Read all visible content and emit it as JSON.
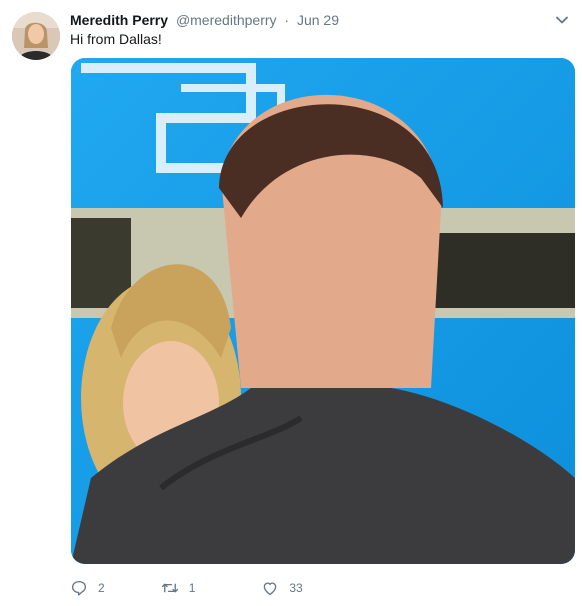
{
  "tweet": {
    "author_name": "Meredith Perry",
    "author_handle": "@meredithperry",
    "separator": "·",
    "date": "Jun 29",
    "text": "Hi from Dallas!",
    "replies": "2",
    "retweets": "1",
    "likes": "33"
  },
  "icons": {
    "avatar": "avatar-image",
    "menu": "chevron-down-icon",
    "reply": "reply-icon",
    "retweet": "retweet-icon",
    "like": "heart-icon"
  },
  "colors": {
    "name": "#14171a",
    "secondary": "#657786",
    "photo_background": "#1aa0e8"
  }
}
